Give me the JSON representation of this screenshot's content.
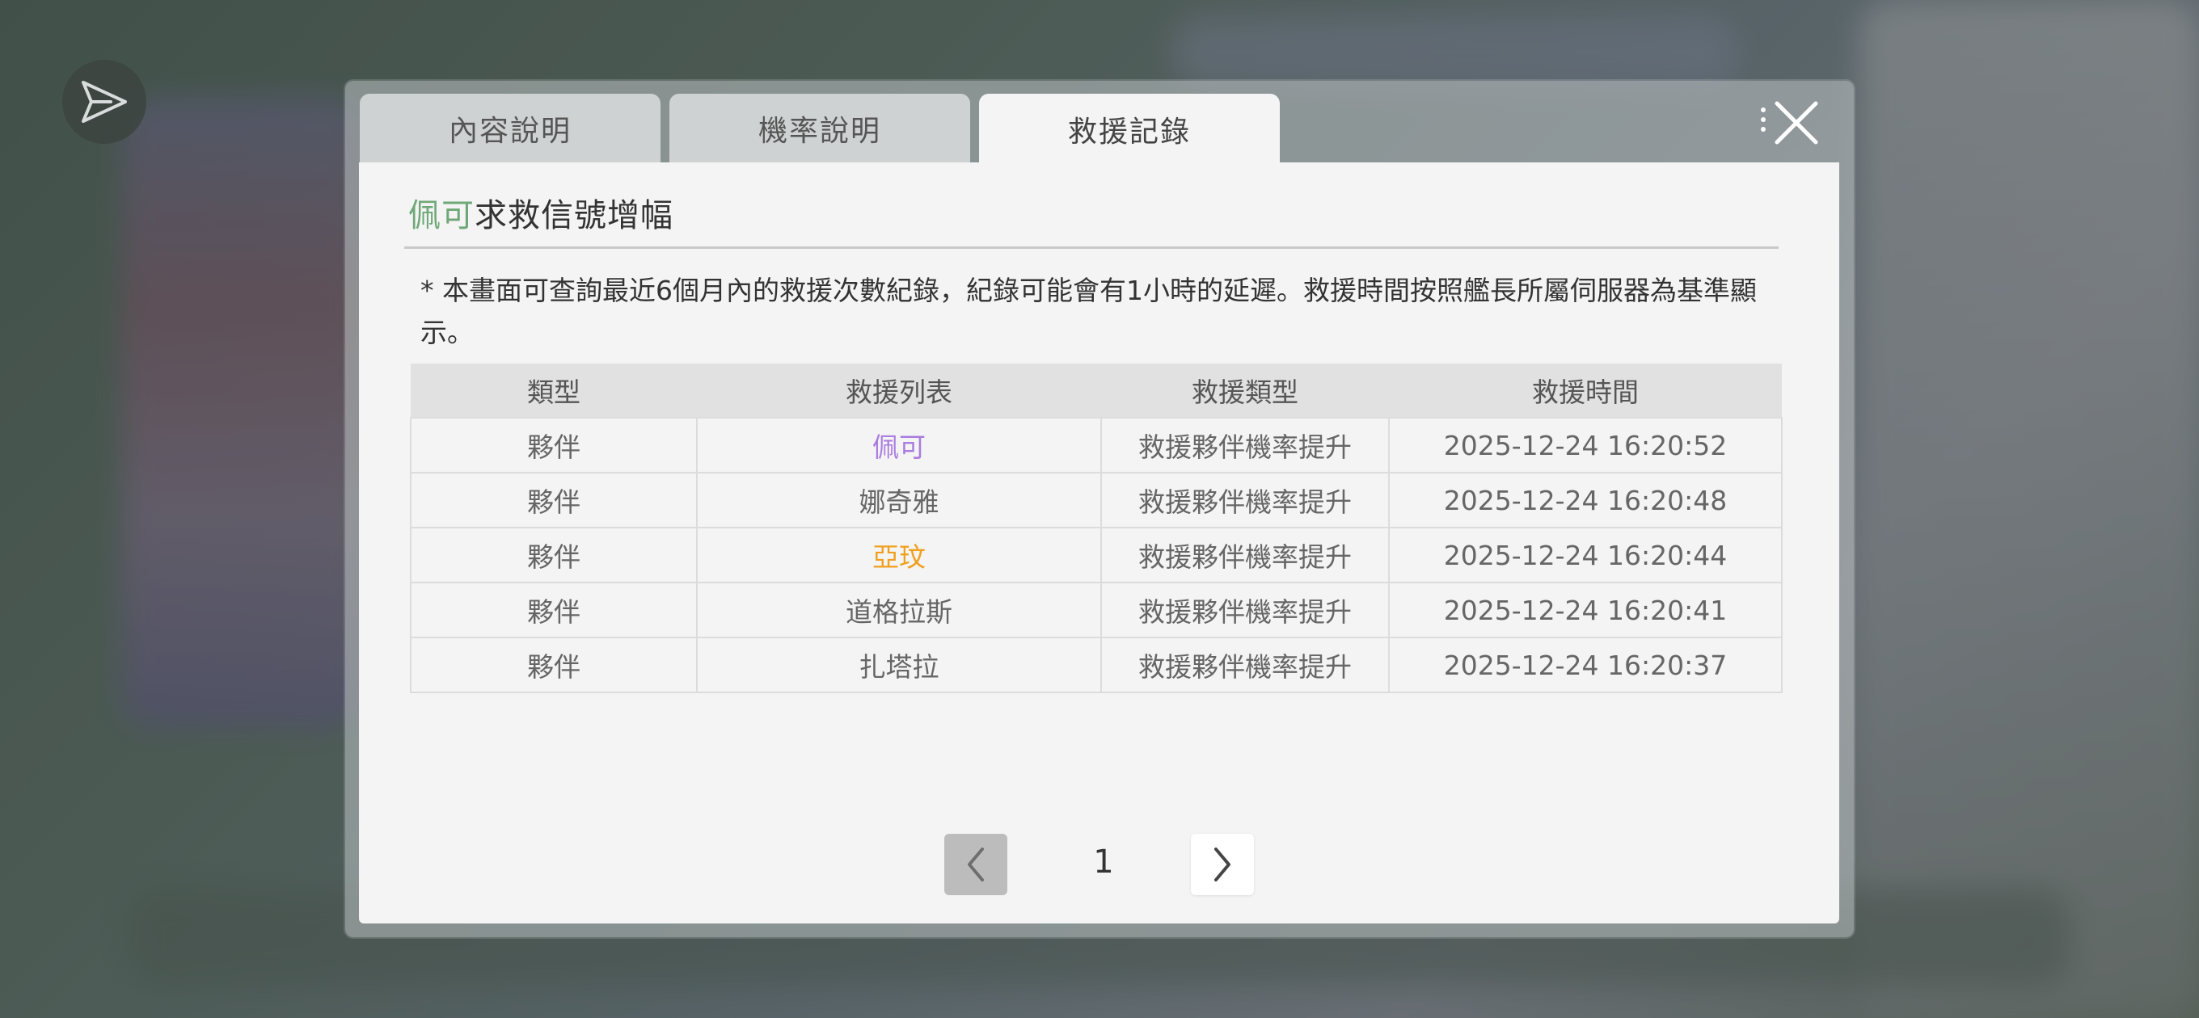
{
  "tabs": [
    {
      "label": "內容說明",
      "active": false
    },
    {
      "label": "機率說明",
      "active": false
    },
    {
      "label": "救援記錄",
      "active": true
    }
  ],
  "header": {
    "title_highlight": "佩可",
    "title_rest": "求救信號增幅",
    "highlight_color": "#6fa878"
  },
  "notice": "* 本畫面可查詢最近6個月內的救援次數紀錄，紀錄可能會有1小時的延遲。救援時間按照艦長所屬伺服器為基準顯示。",
  "table": {
    "columns": [
      "類型",
      "救援列表",
      "救援類型",
      "救援時間"
    ],
    "rows": [
      {
        "type": "夥伴",
        "name": "佩可",
        "name_color": "#a97ce0",
        "rescue_type": "救援夥伴機率提升",
        "time": "2025-12-24 16:20:52"
      },
      {
        "type": "夥伴",
        "name": "娜奇雅",
        "name_color": "#333333",
        "rescue_type": "救援夥伴機率提升",
        "time": "2025-12-24 16:20:48"
      },
      {
        "type": "夥伴",
        "name": "亞玟",
        "name_color": "#f0a020",
        "rescue_type": "救援夥伴機率提升",
        "time": "2025-12-24 16:20:44"
      },
      {
        "type": "夥伴",
        "name": "道格拉斯",
        "name_color": "#333333",
        "rescue_type": "救援夥伴機率提升",
        "time": "2025-12-24 16:20:41"
      },
      {
        "type": "夥伴",
        "name": "扎塔拉",
        "name_color": "#333333",
        "rescue_type": "救援夥伴機率提升",
        "time": "2025-12-24 16:20:37"
      }
    ]
  },
  "pagination": {
    "current_page": "1"
  },
  "icons": {
    "share": "paper-plane-icon",
    "close": "close-icon",
    "prev": "chevron-left-icon",
    "next": "chevron-right-icon"
  }
}
